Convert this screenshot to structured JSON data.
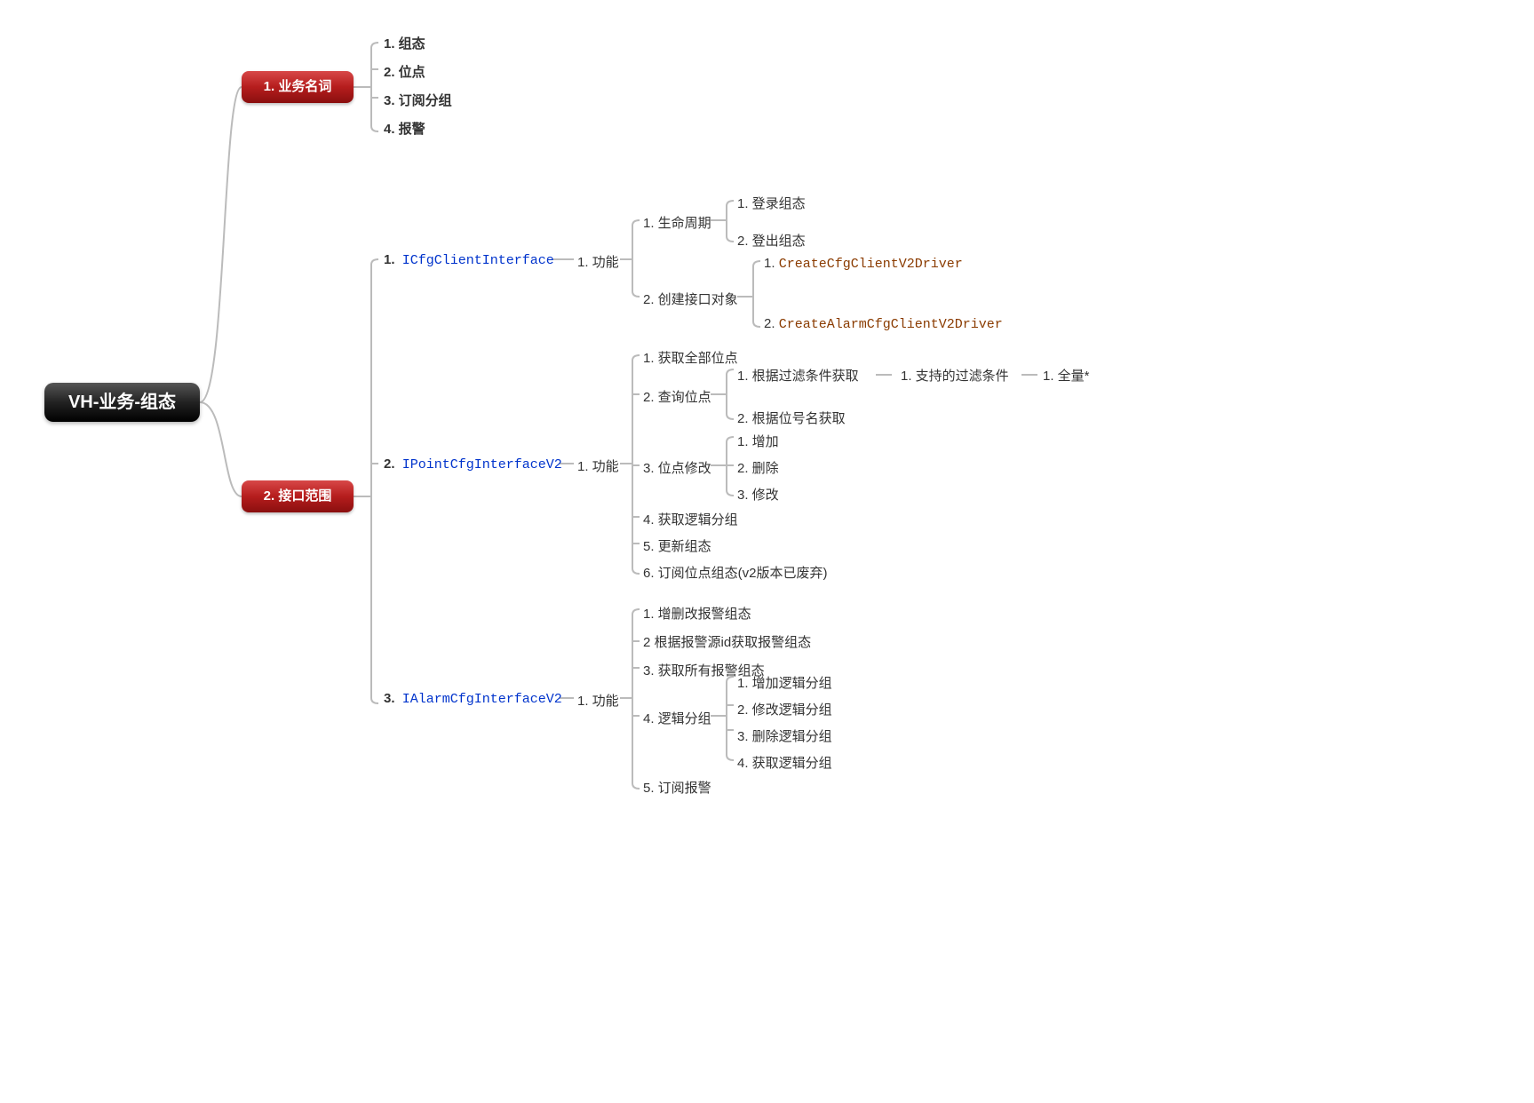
{
  "root": "VH-业务-组态",
  "branch1": {
    "title": "1. 业务名词",
    "items": [
      "1. 组态",
      "2. 位点",
      "3. 订阅分组",
      "4. 报警"
    ]
  },
  "branch2": {
    "title": "2. 接口范围"
  },
  "if1": {
    "num": "1.",
    "name": "ICfgClientInterface",
    "fn": "1. 功能",
    "a": {
      "label": "1. 生命周期",
      "c": [
        "1. 登录组态",
        "2. 登出组态"
      ]
    },
    "b": {
      "label": "2. 创建接口对象",
      "c": [
        "1. ",
        "2. "
      ],
      "code": [
        "CreateCfgClientV2Driver",
        "CreateAlarmCfgClientV2Driver"
      ]
    }
  },
  "if2": {
    "num": "2.",
    "name": "IPointCfgInterfaceV2",
    "fn": "1. 功能",
    "i1": "1. 获取全部位点",
    "i2": {
      "label": "2. 查询位点",
      "c1": "1. 根据过滤条件获取",
      "c2": "2. 根据位号名获取",
      "d": "1. 支持的过滤条件",
      "e": "1. 全量*"
    },
    "i3": {
      "label": "3. 位点修改",
      "c": [
        "1. 增加",
        "2. 删除",
        "3. 修改"
      ]
    },
    "i4": "4. 获取逻辑分组",
    "i5": "5. 更新组态",
    "i6": "6. 订阅位点组态(v2版本已废弃)"
  },
  "if3": {
    "num": "3.",
    "name": "IAlarmCfgInterfaceV2",
    "fn": "1. 功能",
    "i1": "1. 增删改报警组态",
    "i2": "2 根据报警源id获取报警组态",
    "i3": "3. 获取所有报警组态",
    "i4": {
      "label": "4. 逻辑分组",
      "c": [
        "1. 增加逻辑分组",
        "2. 修改逻辑分组",
        "3. 删除逻辑分组",
        "4. 获取逻辑分组"
      ]
    },
    "i5": "5. 订阅报警"
  }
}
